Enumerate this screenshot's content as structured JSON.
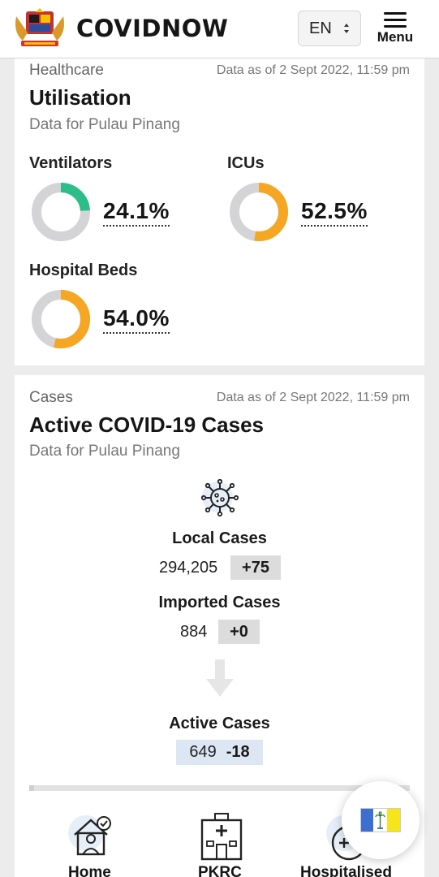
{
  "header": {
    "brand": "COVIDNOW",
    "language": "EN",
    "menu_label": "Menu"
  },
  "utilisation": {
    "eyebrow": "Healthcare",
    "as_of": "Data as of 2 Sept 2022, 11:59 pm",
    "title": "Utilisation",
    "subtitle": "Data for Pulau Pinang",
    "metrics": [
      {
        "label": "Ventilators",
        "value": "24.1%",
        "fraction": 0.241,
        "color": "#2dbd8a"
      },
      {
        "label": "ICUs",
        "value": "52.5%",
        "fraction": 0.525,
        "color": "#f5a623"
      },
      {
        "label": "Hospital Beds",
        "value": "54.0%",
        "fraction": 0.54,
        "color": "#f5a623"
      }
    ],
    "track_color": "#d4d4d6"
  },
  "cases": {
    "eyebrow": "Cases",
    "as_of": "Data as of 2 Sept 2022, 11:59 pm",
    "title": "Active COVID-19 Cases",
    "subtitle": "Data for Pulau Pinang",
    "local": {
      "label": "Local Cases",
      "value": "294,205",
      "delta": "+75"
    },
    "imported": {
      "label": "Imported Cases",
      "value": "884",
      "delta": "+0"
    },
    "active": {
      "label": "Active Cases",
      "value": "649",
      "delta": "-18"
    },
    "tiles": [
      {
        "label": "Home",
        "icon": "home-quarantine-icon"
      },
      {
        "label": "PKRC",
        "icon": "pkrc-building-icon"
      },
      {
        "label": "Hospitalised",
        "icon": "hospitalised-icon"
      }
    ]
  },
  "fab": {
    "icon": "penang-flag-icon"
  }
}
